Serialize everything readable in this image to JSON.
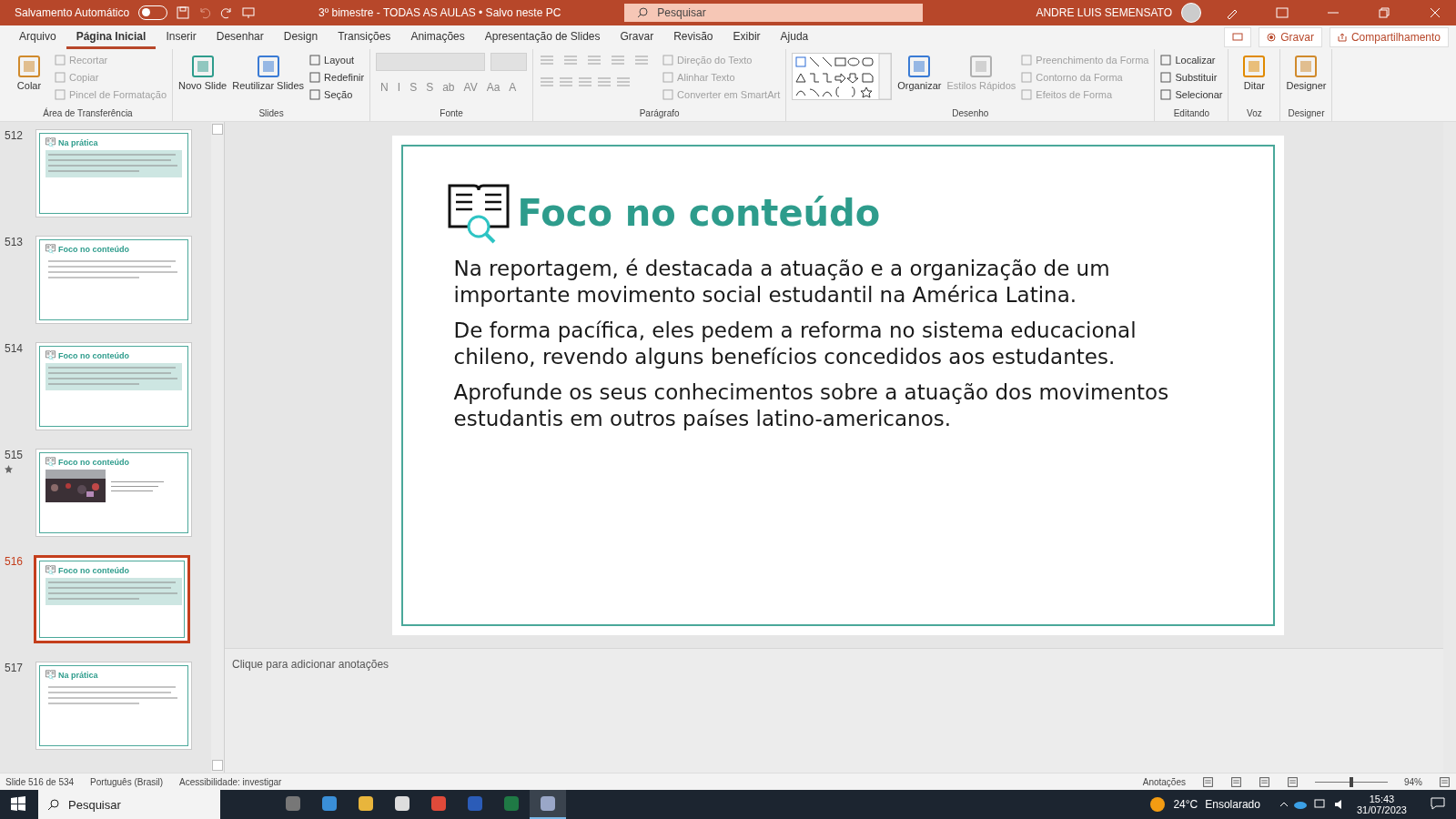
{
  "titlebar": {
    "autosave_label": "Salvamento Automático",
    "autosave_on": false,
    "document_title": "3º bimestre - TODAS AS AULAS • Salvo neste PC",
    "search_placeholder": "Pesquisar",
    "user": "ANDRE LUIS SEMENSATO"
  },
  "menu_tabs": [
    {
      "label": "Arquivo",
      "selected": false
    },
    {
      "label": "Página Inicial",
      "selected": true
    },
    {
      "label": "Inserir",
      "selected": false
    },
    {
      "label": "Desenhar",
      "selected": false
    },
    {
      "label": "Design",
      "selected": false
    },
    {
      "label": "Transições",
      "selected": false
    },
    {
      "label": "Animações",
      "selected": false
    },
    {
      "label": "Apresentação de Slides",
      "selected": false
    },
    {
      "label": "Gravar",
      "selected": false
    },
    {
      "label": "Revisão",
      "selected": false
    },
    {
      "label": "Exibir",
      "selected": false
    },
    {
      "label": "Ajuda",
      "selected": false
    }
  ],
  "actions": {
    "record": "Gravar",
    "share": "Compartilhamento"
  },
  "ribbon_groups": [
    {
      "label": "Área de Transferência",
      "items": [
        {
          "kind": "large",
          "label": "Colar",
          "disabled": false
        },
        {
          "kind": "small",
          "label": "Recortar",
          "disabled": true
        },
        {
          "kind": "small",
          "label": "Copiar",
          "disabled": true
        },
        {
          "kind": "small",
          "label": "Pincel de Formatação",
          "disabled": true
        }
      ]
    },
    {
      "label": "Slides",
      "items": [
        {
          "kind": "large",
          "label": "Novo Slide",
          "disabled": false
        },
        {
          "kind": "large",
          "label": "Reutilizar Slides",
          "disabled": false
        },
        {
          "kind": "small",
          "label": "Layout",
          "disabled": false
        },
        {
          "kind": "small",
          "label": "Redefinir",
          "disabled": false
        },
        {
          "kind": "small",
          "label": "Seção",
          "disabled": false
        }
      ]
    },
    {
      "label": "Fonte",
      "items": [
        {
          "kind": "font",
          "label": "N",
          "disabled": true
        },
        {
          "kind": "font",
          "label": "I",
          "disabled": true
        },
        {
          "kind": "font",
          "label": "S",
          "disabled": true
        },
        {
          "kind": "font",
          "label": "S",
          "disabled": true
        },
        {
          "kind": "font",
          "label": "ab",
          "disabled": true
        },
        {
          "kind": "font",
          "label": "AV",
          "disabled": true
        },
        {
          "kind": "font",
          "label": "Aa",
          "disabled": true
        },
        {
          "kind": "font",
          "label": "A",
          "disabled": true
        }
      ]
    },
    {
      "label": "Parágrafo",
      "items": [
        {
          "kind": "paragraph",
          "disabled": true
        },
        {
          "kind": "small",
          "label": "Direção do Texto",
          "disabled": true
        },
        {
          "kind": "small",
          "label": "Alinhar Texto",
          "disabled": true
        },
        {
          "kind": "small",
          "label": "Converter em SmartArt",
          "disabled": true
        }
      ]
    },
    {
      "label": "Desenho",
      "items": [
        {
          "kind": "shapes"
        },
        {
          "kind": "large",
          "label": "Organizar",
          "disabled": false
        },
        {
          "kind": "large",
          "label": "Estilos Rápidos",
          "disabled": true
        },
        {
          "kind": "small",
          "label": "Preenchimento da Forma",
          "disabled": true
        },
        {
          "kind": "small",
          "label": "Contorno da Forma",
          "disabled": true
        },
        {
          "kind": "small",
          "label": "Efeitos de Forma",
          "disabled": true
        }
      ]
    },
    {
      "label": "Editando",
      "items": [
        {
          "kind": "small",
          "label": "Localizar",
          "disabled": false
        },
        {
          "kind": "small",
          "label": "Substituir",
          "disabled": false
        },
        {
          "kind": "small",
          "label": "Selecionar",
          "disabled": false
        }
      ]
    },
    {
      "label": "Voz",
      "items": [
        {
          "kind": "large",
          "label": "Ditar",
          "disabled": false
        }
      ]
    },
    {
      "label": "Designer",
      "items": [
        {
          "kind": "large",
          "label": "Designer",
          "disabled": false
        }
      ]
    }
  ],
  "thumbnails": [
    {
      "number": "512",
      "title": "Na prática",
      "kind": "text",
      "starred": false,
      "selected": false
    },
    {
      "number": "513",
      "title": "Foco no conteúdo",
      "kind": "text",
      "starred": false,
      "selected": false
    },
    {
      "number": "514",
      "title": "Foco no conteúdo",
      "kind": "text",
      "starred": false,
      "selected": false
    },
    {
      "number": "515",
      "title": "Foco no conteúdo",
      "starred": true,
      "selected": false
    },
    {
      "number": "516",
      "title": "Foco no conteúdo",
      "kind": "text",
      "starred": false,
      "selected": true
    },
    {
      "number": "517",
      "title": "Na prática",
      "kind": "text",
      "starred": false,
      "selected": false
    }
  ],
  "slide": {
    "title": "Foco no conteúdo",
    "paragraphs": [
      "Na reportagem, é destacada a atuação e a organização de um importante movimento social estudantil na América Latina.",
      "De forma pacífica, eles pedem a reforma no sistema educacional chileno, revendo alguns benefícios concedidos aos estudantes.",
      "Aprofunde os seus conhecimentos sobre a atuação dos movimentos estudantis em outros países latino-americanos."
    ]
  },
  "notes": {
    "placeholder": "Clique para adicionar anotações"
  },
  "status_bar": {
    "slide": "Slide 516 de 534",
    "language": "Português (Brasil)",
    "accessibility": "Acessibilidade: investigar",
    "notes": "Anotações",
    "zoom": "94%",
    "zoom_level": {
      "level": 0.5
    }
  },
  "taskbar": {
    "search_placeholder": "Pesquisar",
    "apps": [
      {
        "selected": false
      },
      {
        "selected": false
      },
      {
        "selected": false
      },
      {
        "selected": false
      },
      {
        "selected": false
      },
      {
        "selected": false
      },
      {
        "selected": false
      },
      {
        "selected": true
      }
    ],
    "temperature": "24°C",
    "weather": "Ensolarado",
    "time": "15:43",
    "date": "31/07/2023"
  }
}
